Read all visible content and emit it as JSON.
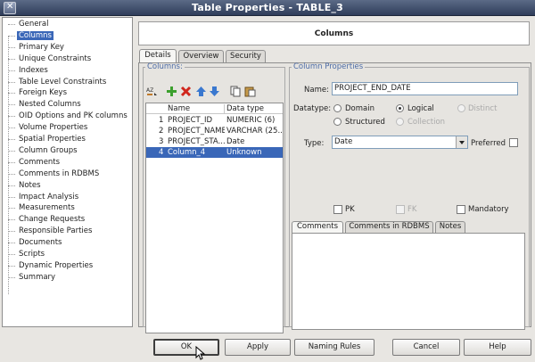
{
  "window": {
    "title": "Table Properties - TABLE_3"
  },
  "nav": {
    "items": [
      {
        "label": "General"
      },
      {
        "label": "Columns",
        "selected": true
      },
      {
        "label": "Primary Key"
      },
      {
        "label": "Unique Constraints"
      },
      {
        "label": "Indexes"
      },
      {
        "label": "Table Level Constraints"
      },
      {
        "label": "Foreign Keys"
      },
      {
        "label": "Nested Columns"
      },
      {
        "label": "OID Options and PK columns"
      },
      {
        "label": "Volume Properties"
      },
      {
        "label": "Spatial Properties"
      },
      {
        "label": "Column Groups"
      },
      {
        "label": "Comments"
      },
      {
        "label": "Comments in RDBMS"
      },
      {
        "label": "Notes"
      },
      {
        "label": "Impact Analysis"
      },
      {
        "label": "Measurements"
      },
      {
        "label": "Change Requests"
      },
      {
        "label": "Responsible Parties"
      },
      {
        "label": "Documents"
      },
      {
        "label": "Scripts"
      },
      {
        "label": "Dynamic Properties"
      },
      {
        "label": "Summary"
      }
    ]
  },
  "header": {
    "title": "Columns"
  },
  "tabs": [
    {
      "label": "Details",
      "active": true
    },
    {
      "label": "Overview"
    },
    {
      "label": "Security"
    }
  ],
  "columns_group": {
    "legend": "Columns:",
    "toolbar": [
      "sort-icon",
      "add-icon",
      "delete-icon",
      "move-up-icon",
      "move-down-icon",
      "copy-icon",
      "paste-icon"
    ],
    "headers": [
      "Name",
      "Data type"
    ],
    "rows": [
      {
        "num": "1",
        "name": "PROJECT_ID",
        "type": "NUMERIC (6)"
      },
      {
        "num": "2",
        "name": "PROJECT_NAME",
        "type": "VARCHAR (25..."
      },
      {
        "num": "3",
        "name": "PROJECT_STA...",
        "type": "Date"
      },
      {
        "num": "4",
        "name": "Column_4",
        "type": "Unknown",
        "selected": true
      }
    ]
  },
  "properties": {
    "legend": "Column Properties",
    "name_label": "Name:",
    "name_value": "PROJECT_END_DATE",
    "datatype_label": "Datatype:",
    "datatype_options": {
      "domain": "Domain",
      "logical": "Logical",
      "distinct": "Distinct",
      "structured": "Structured",
      "collection": "Collection",
      "selected": "Logical"
    },
    "type_label": "Type:",
    "type_value": "Date",
    "preferred_label": "Preferred",
    "pk_label": "PK",
    "fk_label": "FK",
    "mandatory_label": "Mandatory",
    "subtabs": [
      "Comments",
      "Comments in RDBMS",
      "Notes"
    ]
  },
  "buttons": {
    "ok": "OK",
    "apply": "Apply",
    "naming_rules": "Naming Rules",
    "cancel": "Cancel",
    "help": "Help"
  }
}
